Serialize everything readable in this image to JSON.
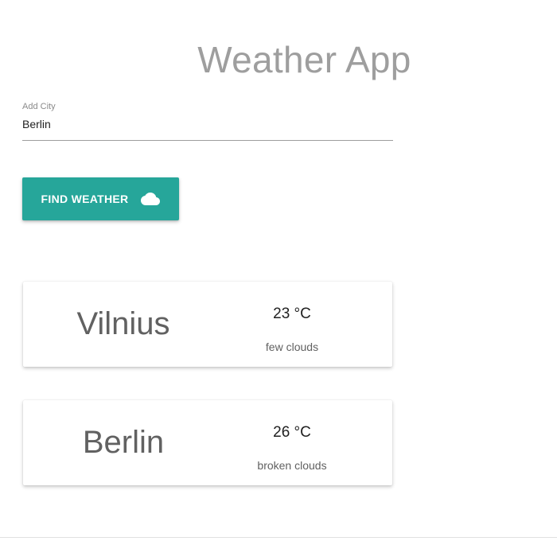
{
  "app": {
    "title": "Weather App"
  },
  "search": {
    "label": "Add City",
    "value": "Berlin",
    "placeholder": ""
  },
  "find_button": {
    "label": "FIND WEATHER",
    "icon": "cloud-icon",
    "color": "#26a69a"
  },
  "cards": [
    {
      "city": "Vilnius",
      "temperature": "23 °C",
      "description": "few clouds"
    },
    {
      "city": "Berlin",
      "temperature": "26 °C",
      "description": "broken clouds"
    }
  ]
}
